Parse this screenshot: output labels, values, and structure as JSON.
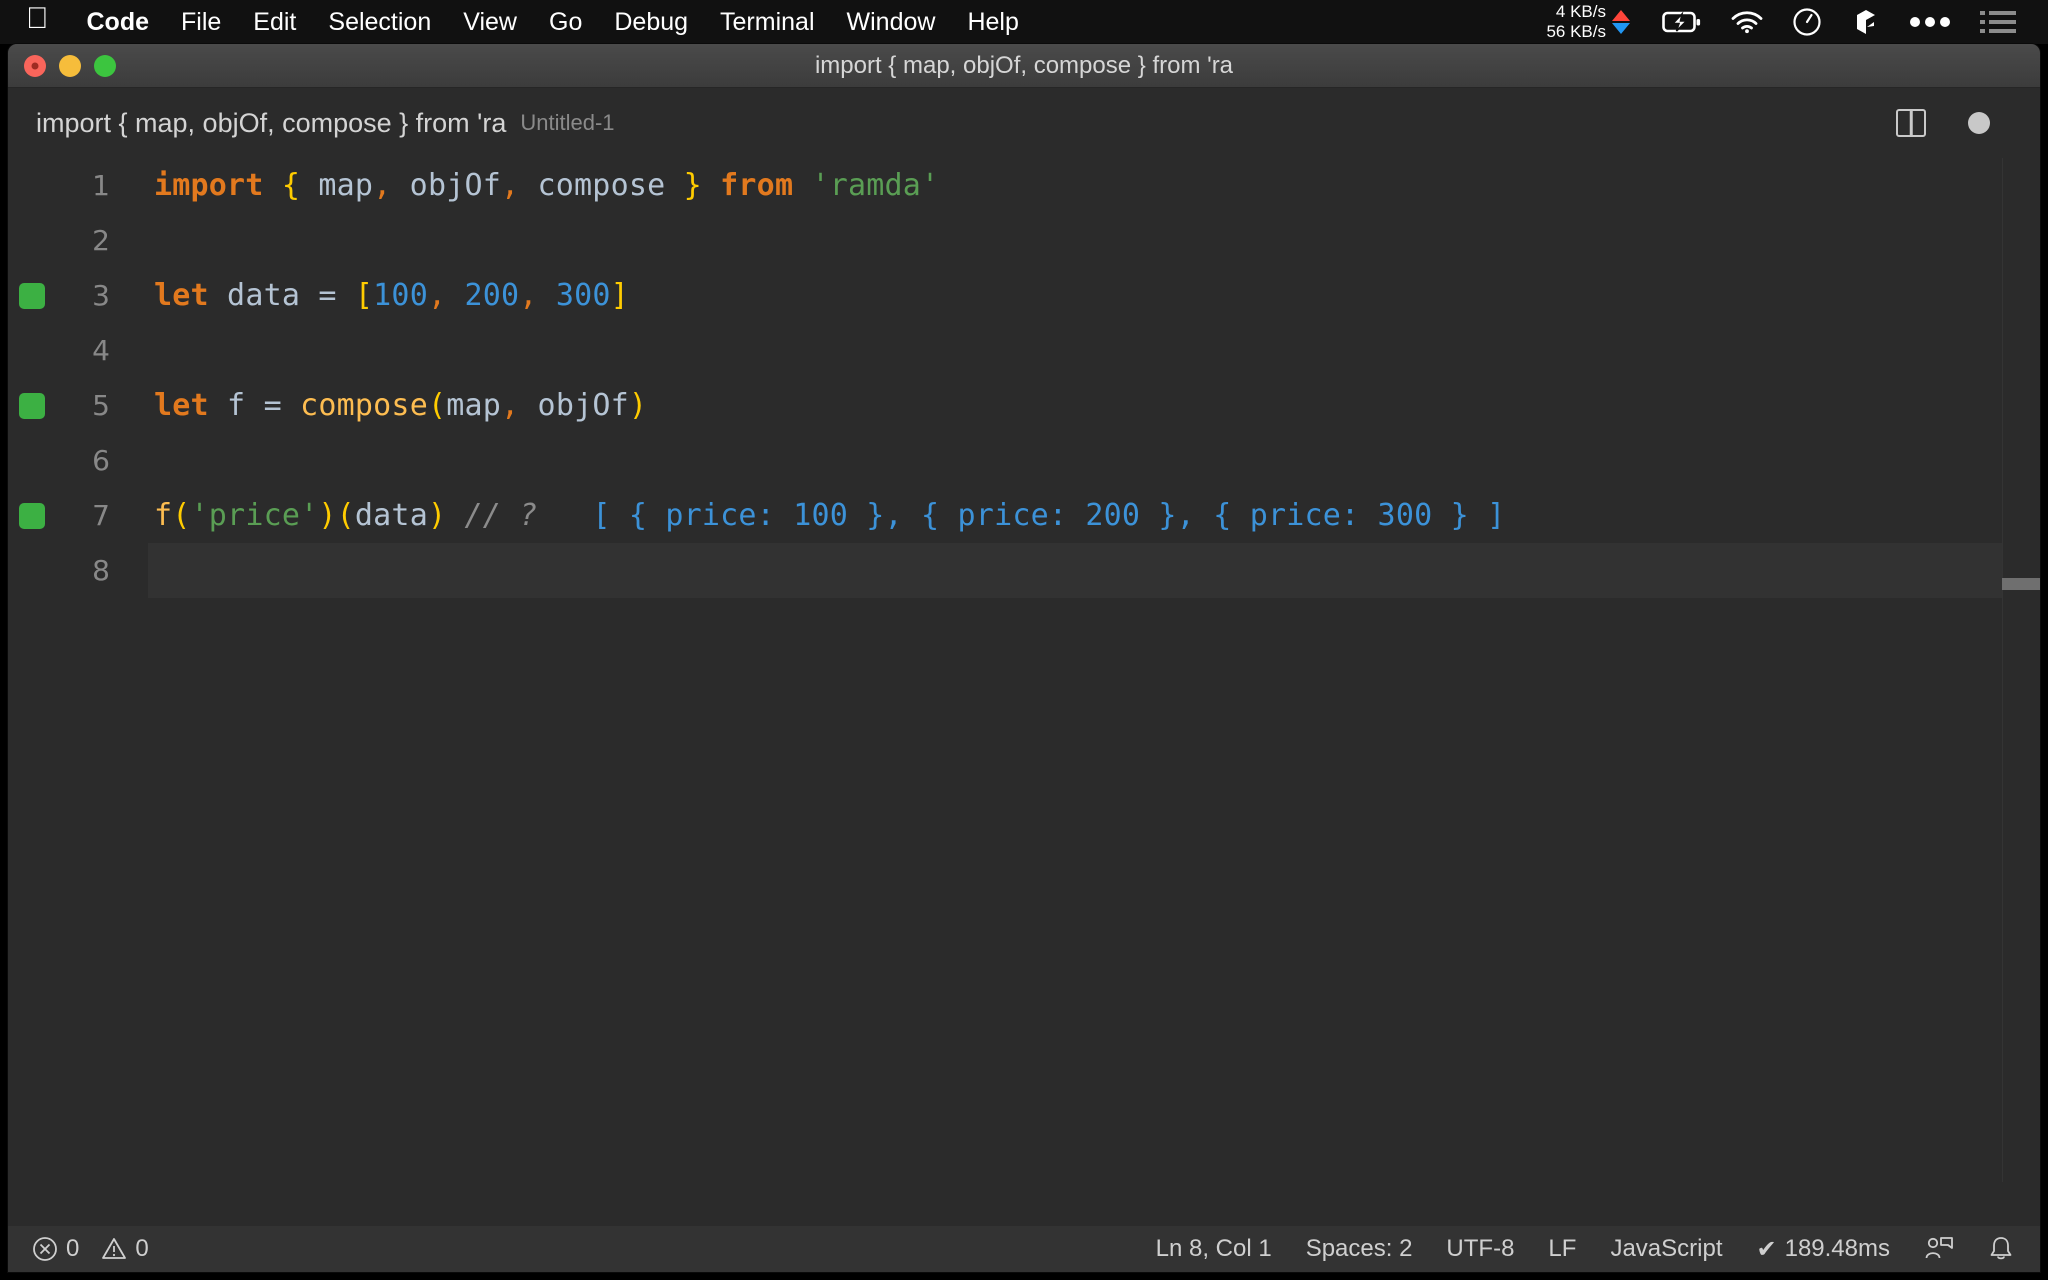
{
  "menubar": {
    "apple_icon": "apple-logo-icon",
    "items": [
      {
        "label": "Code",
        "bold": true
      },
      {
        "label": "File",
        "bold": false
      },
      {
        "label": "Edit",
        "bold": false
      },
      {
        "label": "Selection",
        "bold": false
      },
      {
        "label": "View",
        "bold": false
      },
      {
        "label": "Go",
        "bold": false
      },
      {
        "label": "Debug",
        "bold": false
      },
      {
        "label": "Terminal",
        "bold": false
      },
      {
        "label": "Window",
        "bold": false
      },
      {
        "label": "Help",
        "bold": false
      }
    ],
    "status": {
      "net_up": "4 KB/s",
      "net_down": "56 KB/s",
      "up_arrow_color": "#ff453a",
      "down_arrow_color": "#2196f3",
      "icons": [
        "battery-charging-icon",
        "wifi-icon",
        "clock-icon",
        "dropbox-icon",
        "ellipsis-icon",
        "control-center-list-icon"
      ]
    }
  },
  "window": {
    "title": "import { map, objOf, compose } from 'ra",
    "traffic_lights": [
      "close-button",
      "minimize-button",
      "zoom-button"
    ]
  },
  "tab": {
    "label": "import { map, objOf, compose } from 'ra",
    "sublabel": "Untitled-1",
    "actions": [
      "split-editor-icon",
      "unsaved-indicator-dot"
    ]
  },
  "editor": {
    "language_colors": {
      "keyword": "#e2791e",
      "variable": "#b5c4d4",
      "bracket": "#ffcc00",
      "comma": "#e2791e",
      "number": "#3c92d8",
      "string": "#5a9e54",
      "function": "#fdbd51",
      "comment": "#8b8b8b",
      "inline_result": "#3c92d8",
      "background": "#2b2b2b",
      "gutter_marker": "#3cb043"
    },
    "current_line": 8,
    "lines": [
      {
        "number": "1",
        "marker": false,
        "tokens": [
          {
            "text": "import",
            "cls": "t-kw"
          },
          {
            "text": " ",
            "cls": "t-var"
          },
          {
            "text": "{",
            "cls": "t-punc"
          },
          {
            "text": " map",
            "cls": "t-var"
          },
          {
            "text": ",",
            "cls": "t-comma"
          },
          {
            "text": " objOf",
            "cls": "t-var"
          },
          {
            "text": ",",
            "cls": "t-comma"
          },
          {
            "text": " compose ",
            "cls": "t-var"
          },
          {
            "text": "}",
            "cls": "t-punc"
          },
          {
            "text": " ",
            "cls": "t-var"
          },
          {
            "text": "from",
            "cls": "t-kw"
          },
          {
            "text": " ",
            "cls": "t-var"
          },
          {
            "text": "'ramda'",
            "cls": "t-str"
          }
        ]
      },
      {
        "number": "2",
        "marker": false,
        "tokens": []
      },
      {
        "number": "3",
        "marker": true,
        "tokens": [
          {
            "text": "let",
            "cls": "t-kw"
          },
          {
            "text": " data ",
            "cls": "t-var"
          },
          {
            "text": "=",
            "cls": "t-op"
          },
          {
            "text": " ",
            "cls": "t-var"
          },
          {
            "text": "[",
            "cls": "t-punc"
          },
          {
            "text": "100",
            "cls": "t-num"
          },
          {
            "text": ",",
            "cls": "t-comma"
          },
          {
            "text": " ",
            "cls": "t-var"
          },
          {
            "text": "200",
            "cls": "t-num"
          },
          {
            "text": ",",
            "cls": "t-comma"
          },
          {
            "text": " ",
            "cls": "t-var"
          },
          {
            "text": "300",
            "cls": "t-num"
          },
          {
            "text": "]",
            "cls": "t-punc"
          }
        ]
      },
      {
        "number": "4",
        "marker": false,
        "tokens": []
      },
      {
        "number": "5",
        "marker": true,
        "tokens": [
          {
            "text": "let",
            "cls": "t-kw"
          },
          {
            "text": " f ",
            "cls": "t-var"
          },
          {
            "text": "=",
            "cls": "t-op"
          },
          {
            "text": " ",
            "cls": "t-var"
          },
          {
            "text": "compose",
            "cls": "t-fn"
          },
          {
            "text": "(",
            "cls": "t-punc"
          },
          {
            "text": "map",
            "cls": "t-var"
          },
          {
            "text": ",",
            "cls": "t-comma"
          },
          {
            "text": " objOf",
            "cls": "t-var"
          },
          {
            "text": ")",
            "cls": "t-punc"
          }
        ]
      },
      {
        "number": "6",
        "marker": false,
        "tokens": []
      },
      {
        "number": "7",
        "marker": true,
        "tokens": [
          {
            "text": "f",
            "cls": "t-fn"
          },
          {
            "text": "(",
            "cls": "t-punc"
          },
          {
            "text": "'price'",
            "cls": "t-str"
          },
          {
            "text": ")",
            "cls": "t-punc"
          },
          {
            "text": "(",
            "cls": "t-punc"
          },
          {
            "text": "data",
            "cls": "t-var"
          },
          {
            "text": ")",
            "cls": "t-punc"
          },
          {
            "text": " // ?",
            "cls": "t-comment"
          },
          {
            "text": "   [ { price: 100 }, { price: 200 }, { price: 300 } ]",
            "cls": "t-inline"
          }
        ]
      },
      {
        "number": "8",
        "marker": false,
        "tokens": []
      }
    ]
  },
  "statusbar": {
    "error_count": "0",
    "warning_count": "0",
    "cursor_position": "Ln 8, Col 1",
    "indentation": "Spaces: 2",
    "encoding": "UTF-8",
    "eol": "LF",
    "language": "JavaScript",
    "run_time": "189.48ms",
    "run_check_glyph": "✔",
    "right_icons": [
      "feedback-smiley-icon",
      "notifications-bell-icon"
    ]
  }
}
